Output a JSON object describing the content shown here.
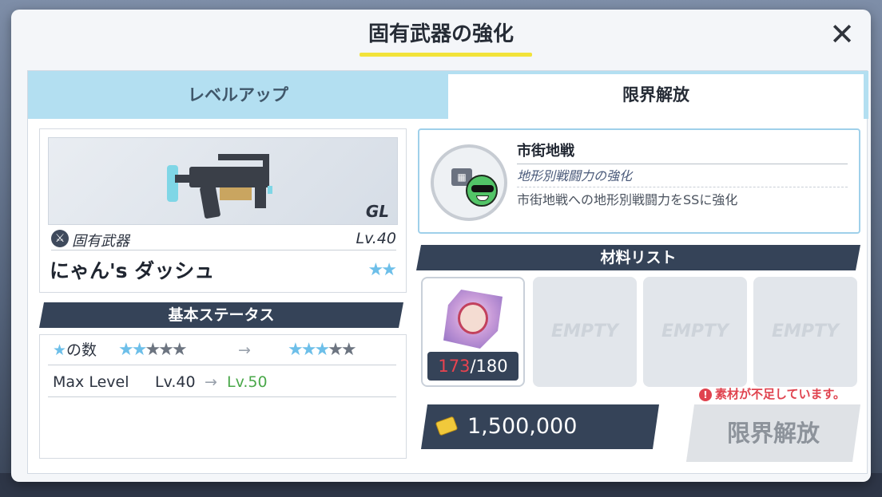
{
  "dialog": {
    "title": "固有武器の強化",
    "close_label": "✕"
  },
  "tabs": [
    {
      "label": "レベルアップ",
      "active": false
    },
    {
      "label": "限界解放",
      "active": true
    }
  ],
  "weapon": {
    "class": "GL",
    "type_label": "固有武器",
    "level": "Lv.40",
    "name": "にゃん's ダッシュ",
    "stars": "★★"
  },
  "status": {
    "header": "基本ステータス",
    "stars_row": {
      "label": "の数",
      "before_blue": "★★",
      "before_grey": "★★★",
      "arrow": "→",
      "after_blue": "★★★",
      "after_grey": "★★"
    },
    "level_row": {
      "label": "Max Level",
      "before": "Lv.40",
      "arrow": "→",
      "after": "Lv.50"
    }
  },
  "terrain": {
    "name": "市街地戦",
    "subtitle": "地形別戦闘力の強化",
    "description": "市街地戦への地形別戦闘力をSSに強化",
    "icon": "city-terrain-icon"
  },
  "materials": {
    "header": "材料リスト",
    "slots": [
      {
        "type": "filled",
        "have": "173",
        "separator": "/",
        "need": "180"
      },
      {
        "type": "empty",
        "label": "EMPTY"
      },
      {
        "type": "empty",
        "label": "EMPTY"
      },
      {
        "type": "empty",
        "label": "EMPTY"
      }
    ]
  },
  "cost": {
    "value": "1,500,000",
    "icon": "credit-icon"
  },
  "warning": {
    "icon": "!",
    "text": "素材が不足しています。"
  },
  "action": {
    "label": "限界解放"
  },
  "colors": {
    "accent_yellow": "#f2e33a",
    "tab_blue": "#b3dff1",
    "navy": "#354358",
    "warning_red": "#e0434f",
    "level_green": "#4aa84a"
  }
}
